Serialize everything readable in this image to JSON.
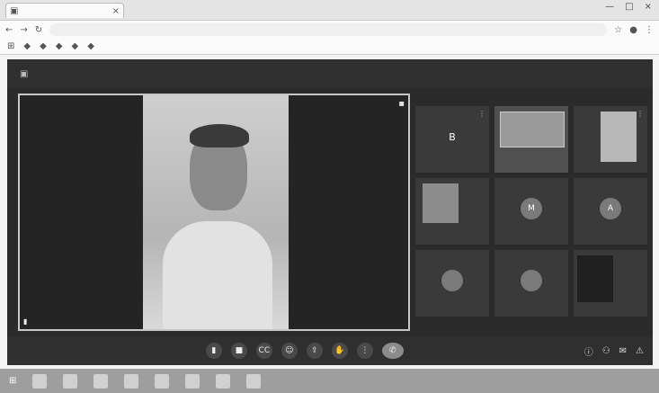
{
  "browser": {
    "tab": {
      "favicon": "meet-icon",
      "close": "×"
    },
    "window_controls": {
      "minimize": "—",
      "maximize": "□",
      "close": "×"
    },
    "nav": {
      "back": "←",
      "forward": "→",
      "reload": "↻"
    }
  },
  "meeting": {
    "main_tile": {
      "pin": "pin-icon"
    },
    "controls": {
      "captions": "CC",
      "hand": "✋",
      "present": "⇪",
      "emoji": "☺",
      "more": "⋮",
      "end": "✆"
    },
    "side_tools": {
      "info": "ⓘ",
      "people": "👥",
      "chat": "💬",
      "activities": "⚠"
    },
    "tiles": [
      {
        "initial": "B"
      },
      {
        "initial": ""
      },
      {
        "initial": ""
      },
      {
        "initial": ""
      },
      {
        "initial": "M"
      },
      {
        "initial": "A"
      },
      {
        "initial": ""
      },
      {
        "initial": ""
      },
      {
        "initial": ""
      }
    ]
  },
  "colors": {
    "meeting_bg": "#2b2b2b",
    "tile_bg": "#3a3a3a",
    "border_active": "#c7c7c7"
  }
}
